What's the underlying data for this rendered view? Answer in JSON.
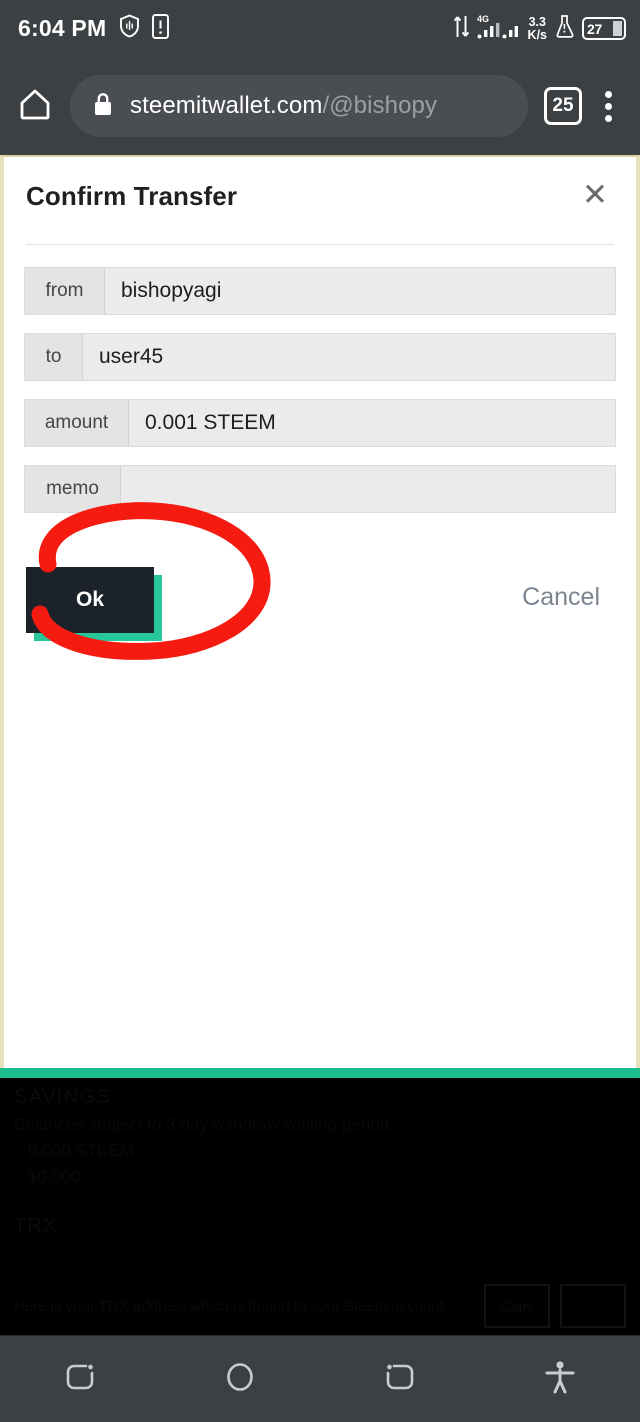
{
  "status_bar": {
    "time": "6:04 PM",
    "icons": [
      "shield-icon",
      "sim-card-icon"
    ],
    "network_speed": {
      "value": "3.3",
      "unit": "K/s"
    },
    "network_type": "4G",
    "battery_level": "27"
  },
  "browser": {
    "home_icon": "home-icon",
    "lock_icon": "lock-icon",
    "url_domain": "steemitwallet.com",
    "url_path": "/@bishopy",
    "tab_count": "25",
    "menu_icon": "kebab-menu-icon"
  },
  "modal": {
    "title": "Confirm Transfer",
    "close_icon": "close-icon",
    "fields": [
      {
        "label": "from",
        "value": "bishopyagi"
      },
      {
        "label": "to",
        "value": "user45"
      },
      {
        "label": "amount",
        "value": "0.001 STEEM"
      },
      {
        "label": "memo",
        "value": ""
      }
    ],
    "ok_label": "Ok",
    "cancel_label": "Cancel",
    "ok_button_color": "#1b2229",
    "ok_shadow_color": "#27c79b",
    "annotation": "red-circle-highlight"
  },
  "background_page": {
    "savings_heading": "SAVINGS",
    "savings_note": "Balances subject to 3 day withdraw waiting period.",
    "savings_steem": "0.000 STEEM",
    "savings_sbd": "$0.000",
    "trx_heading": "TRX",
    "trx_address": "Here is your TRX address which is bound to your Steem account",
    "trx_copy_label": "Copy",
    "accent_color": "#1fcc9a"
  },
  "nav_bar": {
    "items": [
      {
        "icon": "recents-icon"
      },
      {
        "icon": "home-circle-icon"
      },
      {
        "icon": "back-icon"
      },
      {
        "icon": "accessibility-icon"
      }
    ]
  }
}
